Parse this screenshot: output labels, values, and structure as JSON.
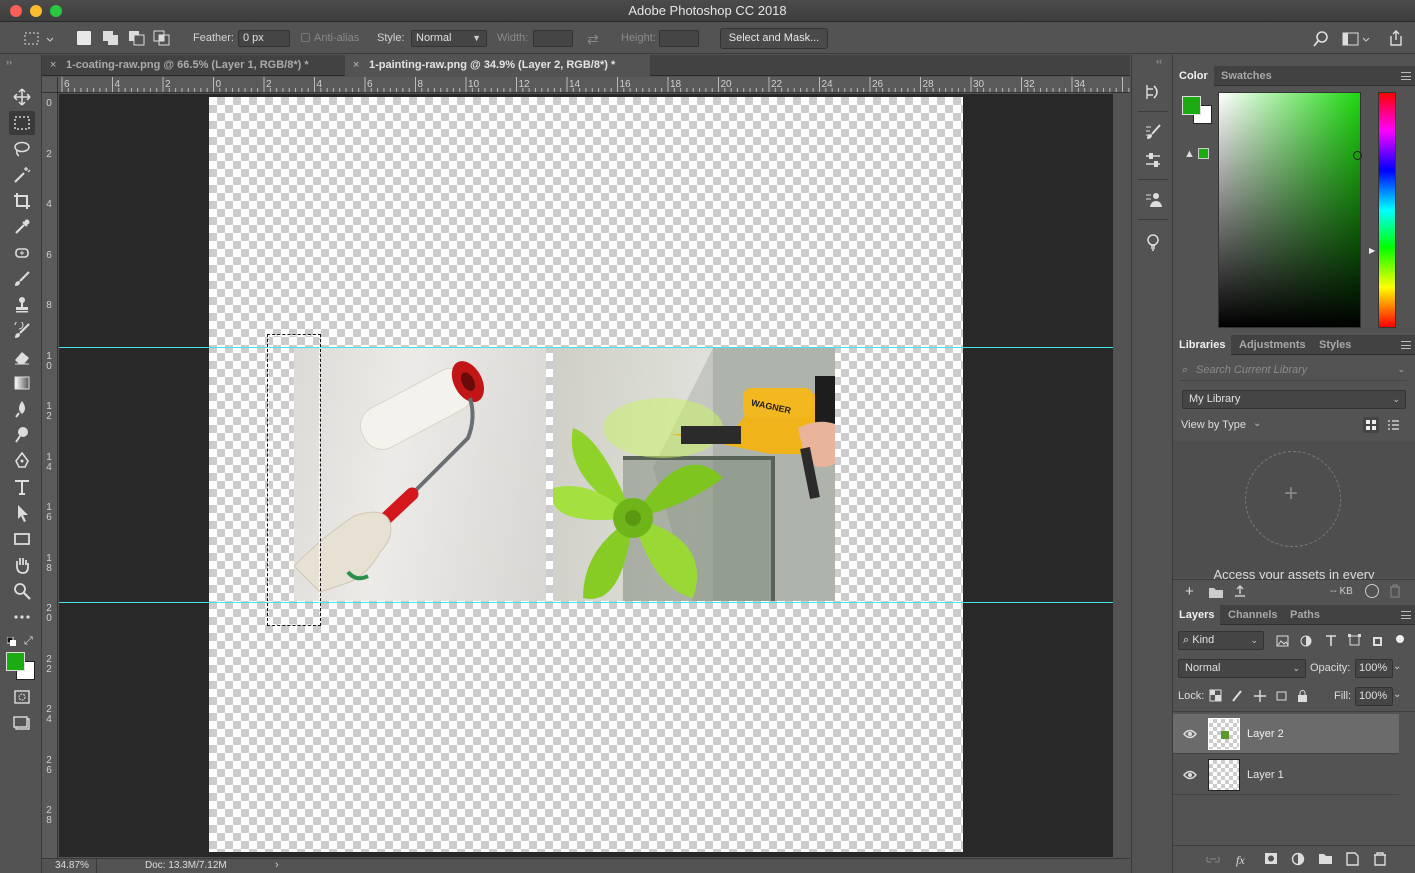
{
  "window": {
    "title": "Adobe Photoshop CC 2018"
  },
  "options_bar": {
    "feather_label": "Feather:",
    "feather_value": "0 px",
    "antialias_label": "Anti-alias",
    "style_label": "Style:",
    "style_value": "Normal",
    "width_label": "Width:",
    "height_label": "Height:",
    "select_mask_label": "Select and Mask..."
  },
  "doc_tabs": [
    {
      "label": "1-coating-raw.png @ 66.5% (Layer 1, RGB/8*) *",
      "active": false
    },
    {
      "label": "1-painting-raw.png @ 34.9% (Layer 2, RGB/8*) *",
      "active": true
    }
  ],
  "rulers": {
    "top": [
      "6",
      "4",
      "2",
      "0",
      "2",
      "4",
      "6",
      "8",
      "10",
      "12",
      "14",
      "16",
      "18",
      "20",
      "22",
      "24",
      "26",
      "28",
      "30",
      "32",
      "34"
    ],
    "left": [
      "0",
      "2",
      "4",
      "6",
      "8",
      "1\n0",
      "1\n2",
      "1\n4",
      "1\n6",
      "1\n8",
      "2\n0",
      "2\n2",
      "2\n4",
      "2\n6",
      "2\n8"
    ]
  },
  "status": {
    "zoom": "34.87%",
    "doc": "Doc: 13.3M/7.12M"
  },
  "color_panel": {
    "tabs": [
      "Color",
      "Swatches"
    ],
    "foreground": "#1dab12",
    "background": "#ffffff"
  },
  "libraries_panel": {
    "tabs": [
      "Libraries",
      "Adjustments",
      "Styles"
    ],
    "search_placeholder": "Search Current Library",
    "library": "My Library",
    "view_by": "View by Type",
    "empty_text": "Access your assets in every",
    "size": "-- KB"
  },
  "layers_panel": {
    "tabs": [
      "Layers",
      "Channels",
      "Paths"
    ],
    "filter": "Kind",
    "blend_mode": "Normal",
    "opacity_label": "Opacity:",
    "opacity_value": "100%",
    "lock_label": "Lock:",
    "fill_label": "Fill:",
    "fill_value": "100%",
    "layers": [
      {
        "name": "Layer 2",
        "selected": true
      },
      {
        "name": "Layer 1",
        "selected": false
      }
    ]
  },
  "colors": {
    "guide": "#3ee6ea",
    "fg": "#1dab12"
  }
}
